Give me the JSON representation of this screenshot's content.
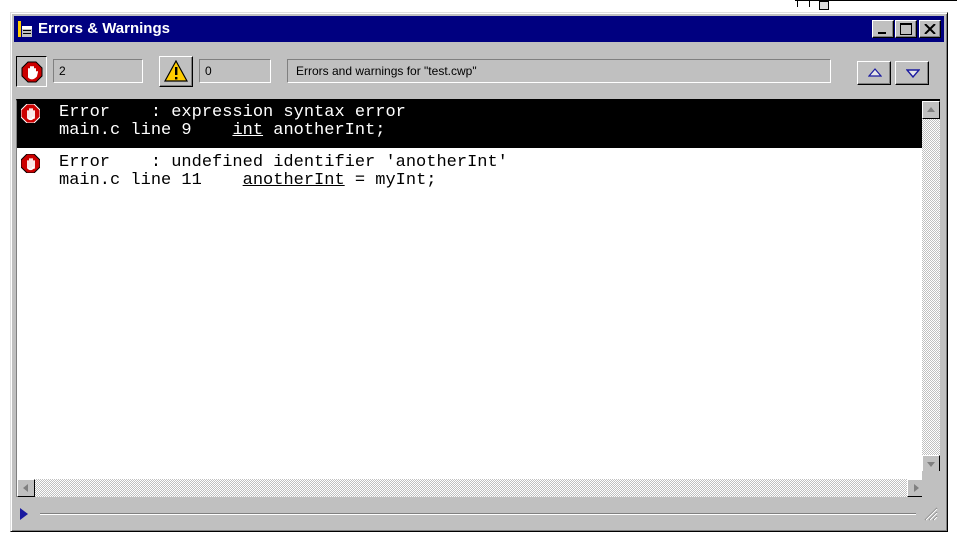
{
  "window": {
    "title": "Errors & Warnings"
  },
  "toolbar": {
    "error_count": "2",
    "warning_count": "0",
    "status_message": "Errors and warnings for \"test.cwp\""
  },
  "messages": [
    {
      "kind": "Error",
      "text": "Error    : expression syntax error",
      "location": "main.c line 9    ",
      "code_token": "int",
      "code_rest": " anotherInt;",
      "selected": true
    },
    {
      "kind": "Error",
      "text": "Error    : undefined identifier 'anotherInt'",
      "location": "main.c line 11    ",
      "code_token": "anotherInt",
      "code_rest": " = myInt;",
      "selected": false
    }
  ],
  "icons": {
    "error": "stop-hand-icon",
    "warning": "warning-triangle-icon"
  },
  "colors": {
    "titlebar": "#000080",
    "selection": "#000000",
    "error_red": "#cc0000",
    "warning_yellow": "#ffcc00"
  }
}
